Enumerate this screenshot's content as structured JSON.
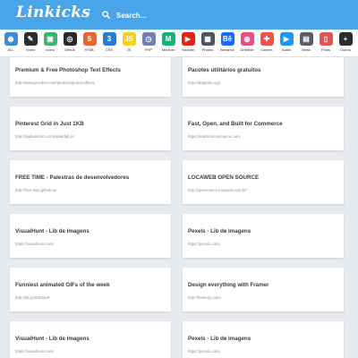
{
  "header": {
    "logo": "Linkicks",
    "search_placeholder": "Search...",
    "accent_color": "#49a5ea"
  },
  "categories": [
    {
      "label": "ALL",
      "icon": "globe-icon",
      "color": "#3d8bd4",
      "glyph": "◉"
    },
    {
      "label": "Vídeo",
      "icon": "brush-icon",
      "color": "#2a2d33",
      "glyph": "✎"
    },
    {
      "label": "Icons",
      "icon": "box-icon",
      "color": "#3cb371",
      "glyph": "▣"
    },
    {
      "label": "Github",
      "icon": "github-icon",
      "color": "#24292e",
      "glyph": "◎"
    },
    {
      "label": "HTML",
      "icon": "html5-icon",
      "color": "#e8672f",
      "glyph": "5"
    },
    {
      "label": "CSS",
      "icon": "css3-icon",
      "color": "#2b7bd0",
      "glyph": "3"
    },
    {
      "label": "JS",
      "icon": "js-icon",
      "color": "#f5d11b",
      "glyph": "JS"
    },
    {
      "label": "PHP",
      "icon": "php-icon",
      "color": "#6f7fb3",
      "glyph": "◷"
    },
    {
      "label": "Medium",
      "icon": "medium-icon",
      "color": "#17b07a",
      "glyph": "M"
    },
    {
      "label": "Youtube",
      "icon": "youtube-icon",
      "color": "#e62117",
      "glyph": "▶"
    },
    {
      "label": "Photos",
      "icon": "photos-icon",
      "color": "#4a5560",
      "glyph": "▦"
    },
    {
      "label": "Behance",
      "icon": "behance-icon",
      "color": "#1769ff",
      "glyph": "Bē"
    },
    {
      "label": "Dribbble",
      "icon": "dribbble-icon",
      "color": "#ea4c89",
      "glyph": "◍"
    },
    {
      "label": "Games",
      "icon": "gamepad-icon",
      "color": "#ef5350",
      "glyph": "✚"
    },
    {
      "label": "Autos",
      "icon": "play-store-icon",
      "color": "#2196f3",
      "glyph": "▶"
    },
    {
      "label": "News",
      "icon": "newspaper-icon",
      "color": "#555d66",
      "glyph": "▤"
    },
    {
      "label": "Posts",
      "icon": "mobile-icon",
      "color": "#e25555",
      "glyph": "▯"
    },
    {
      "label": "Outros",
      "icon": "plus-icon",
      "color": "#2a2d33",
      "glyph": "+"
    }
  ],
  "links": [
    {
      "title": "Premium & Free Photoshop Text Effects",
      "url": "http://www.pixeden.com/photoshop-text-effects"
    },
    {
      "title": "Pacotes utilitários gratuitos",
      "url": "http://ahsprato.org/"
    },
    {
      "title": "Pinterest Grid in Just 1KB",
      "url": "http://raphamorim.com/waterfall.js/"
    },
    {
      "title": "Fast, Open, and Built for Commerce",
      "url": "https://reactioncommerce.com/"
    },
    {
      "title": "FREE TIME - Palestras de desenvolvedores",
      "url": "http://free-time.github.io/"
    },
    {
      "title": "LOCAWEB OPEN SOURCE",
      "url": "http://opensource.locaweb.com.br/"
    },
    {
      "title": "VisualHunt - Lib de imagens",
      "url": "https://visualhunt.com/"
    },
    {
      "title": "Pexels - Lib de imagens",
      "url": "https://pexels.com/"
    },
    {
      "title": "Funniest animated GIFs of the week",
      "url": "http://bit.ly/2b9zisuP"
    },
    {
      "title": "Design everything with Framer",
      "url": "http://framerjs.com/"
    },
    {
      "title": "VisualHunt - Lib de imagens",
      "url": "https://visualhunt.com/"
    },
    {
      "title": "Pexels - Lib de imagens",
      "url": "https://pexels.com/"
    }
  ]
}
